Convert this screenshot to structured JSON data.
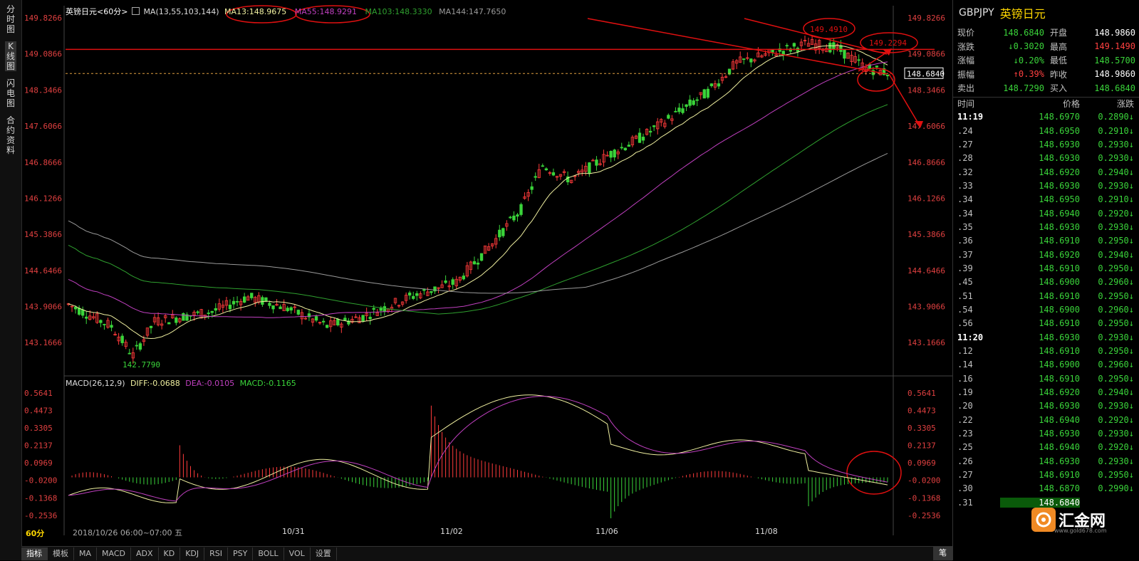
{
  "left_tabs": [
    "分时图",
    "K线图",
    "闪电图",
    "合约资料"
  ],
  "main_legend": {
    "name": "英镑日元<60分>",
    "ma_label": "MA(13,55,103,144)",
    "ma13": "MA13:148.9675",
    "ma55": "MA55:148.9291",
    "ma103": "MA103:148.3330",
    "ma144": "MA144:147.7650"
  },
  "macd_legend": {
    "label": "MACD(26,12,9)",
    "diff": "DIFF:-0.0688",
    "dea": "DEA:-0.0105",
    "macd": "MACD:-0.1165"
  },
  "price_axis": [
    "149.8266",
    "149.0866",
    "148.3466",
    "147.6066",
    "146.8666",
    "146.1266",
    "145.3866",
    "144.6466",
    "143.9066",
    "143.1666"
  ],
  "macd_axis": [
    "0.5641",
    "0.4473",
    "0.3305",
    "0.2137",
    "0.0969",
    "-0.0200",
    "-0.1368",
    "-0.2536"
  ],
  "annotations": {
    "high_label": "149.4910",
    "right_high_label": "149.2294",
    "low_label": "142.7790",
    "current_price_box": "148.6840"
  },
  "time_bar": {
    "period": "60分",
    "cursor": "2018/10/26 06:00~07:00 五",
    "dates": [
      "10/31",
      "11/02",
      "11/06",
      "11/08"
    ]
  },
  "bottom_tabs": [
    "指标",
    "模板",
    "MA",
    "MACD",
    "ADX",
    "KD",
    "KDJ",
    "RSI",
    "PSY",
    "BOLL",
    "VOL",
    "设置"
  ],
  "right_tab": "笔",
  "quote": {
    "symbol": "GBPJPY",
    "name": "英镑日元",
    "rows": [
      {
        "l": "现价",
        "v": "148.6840",
        "vc": "dn",
        "l2": "开盘",
        "v2": "148.9860",
        "v2c": "w"
      },
      {
        "l": "涨跌",
        "v": "↓0.3020",
        "vc": "dn",
        "l2": "最高",
        "v2": "149.1490",
        "v2c": "up"
      },
      {
        "l": "涨幅",
        "v": "↓0.20%",
        "vc": "dn",
        "l2": "最低",
        "v2": "148.5700",
        "v2c": "dn"
      },
      {
        "l": "振幅",
        "v": "↑0.39%",
        "vc": "up",
        "l2": "昨收",
        "v2": "148.9860",
        "v2c": "w"
      },
      {
        "l": "卖出",
        "v": "148.7290",
        "vc": "dn",
        "l2": "买入",
        "v2": "148.6840",
        "v2c": "dn"
      }
    ]
  },
  "ticks_header": {
    "t": "时间",
    "p": "价格",
    "c": "涨跌"
  },
  "ticks": [
    {
      "t": "11:19",
      "p": "148.6970",
      "c": "0.2890↓",
      "bold": true
    },
    {
      "t": ".24",
      "p": "148.6950",
      "c": "0.2910↓"
    },
    {
      "t": ".27",
      "p": "148.6930",
      "c": "0.2930↓"
    },
    {
      "t": ".28",
      "p": "148.6930",
      "c": "0.2930↓"
    },
    {
      "t": ".32",
      "p": "148.6920",
      "c": "0.2940↓"
    },
    {
      "t": ".33",
      "p": "148.6930",
      "c": "0.2930↓"
    },
    {
      "t": ".34",
      "p": "148.6950",
      "c": "0.2910↓"
    },
    {
      "t": ".34",
      "p": "148.6940",
      "c": "0.2920↓"
    },
    {
      "t": ".35",
      "p": "148.6930",
      "c": "0.2930↓"
    },
    {
      "t": ".36",
      "p": "148.6910",
      "c": "0.2950↓"
    },
    {
      "t": ".37",
      "p": "148.6920",
      "c": "0.2940↓"
    },
    {
      "t": ".39",
      "p": "148.6910",
      "c": "0.2950↓"
    },
    {
      "t": ".45",
      "p": "148.6900",
      "c": "0.2960↓"
    },
    {
      "t": ".51",
      "p": "148.6910",
      "c": "0.2950↓"
    },
    {
      "t": ".54",
      "p": "148.6900",
      "c": "0.2960↓"
    },
    {
      "t": ".56",
      "p": "148.6910",
      "c": "0.2950↓"
    },
    {
      "t": "11:20",
      "p": "148.6930",
      "c": "0.2930↓",
      "bold": true
    },
    {
      "t": ".12",
      "p": "148.6910",
      "c": "0.2950↓"
    },
    {
      "t": ".14",
      "p": "148.6900",
      "c": "0.2960↓"
    },
    {
      "t": ".16",
      "p": "148.6910",
      "c": "0.2950↓"
    },
    {
      "t": ".19",
      "p": "148.6920",
      "c": "0.2940↓"
    },
    {
      "t": ".20",
      "p": "148.6930",
      "c": "0.2930↓"
    },
    {
      "t": ".22",
      "p": "148.6940",
      "c": "0.2920↓"
    },
    {
      "t": ".23",
      "p": "148.6930",
      "c": "0.2930↓"
    },
    {
      "t": ".25",
      "p": "148.6940",
      "c": "0.2920↓"
    },
    {
      "t": ".26",
      "p": "148.6930",
      "c": "0.2930↓"
    },
    {
      "t": ".27",
      "p": "148.6910",
      "c": "0.2950↓"
    },
    {
      "t": ".30",
      "p": "148.6870",
      "c": "0.2990↓"
    },
    {
      "t": ".31",
      "p": "148.6840",
      "c": ""
    }
  ],
  "watermark": {
    "text": "汇金网",
    "url": "www.gold678.com"
  },
  "colors": {
    "up": "#ff3b3b",
    "down": "#3ad43a",
    "ma13": "#f0f0a0",
    "ma55": "#c040c0",
    "ma103": "#2fa02f",
    "ma144": "#9a9a9a",
    "annot": "#e01010"
  }
}
